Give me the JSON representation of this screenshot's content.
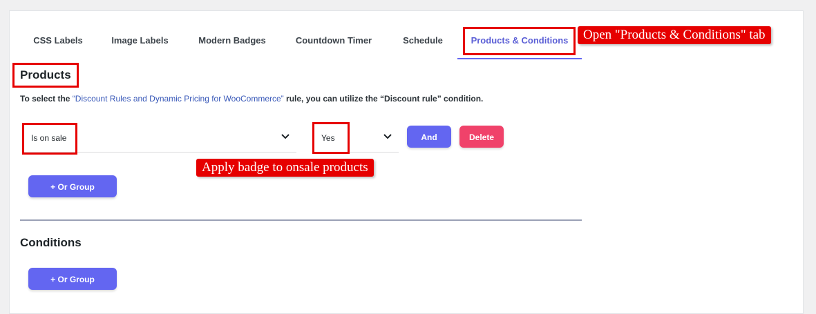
{
  "tabs": [
    {
      "label": "CSS Labels"
    },
    {
      "label": "Image Labels"
    },
    {
      "label": "Modern Badges"
    },
    {
      "label": "Countdown Timer"
    },
    {
      "label": "Schedule"
    },
    {
      "label": "Products & Conditions",
      "active": true
    }
  ],
  "annotations": {
    "open_tab": "Open \"Products & Conditions\" tab",
    "apply_badge": "Apply badge to onsale products"
  },
  "products": {
    "title": "Products",
    "help_prefix": "To select the ",
    "help_link": "“Discount Rules and Dynamic Pricing for WooCommerce”",
    "help_suffix": " rule, you can utilize the “Discount rule” condition.",
    "condition_select": {
      "value": "Is on sale"
    },
    "value_select": {
      "value": "Yes"
    },
    "and_button": "And",
    "delete_button": "Delete",
    "or_group_button": "+ Or Group"
  },
  "conditions": {
    "title": "Conditions",
    "or_group_button": "+ Or Group"
  },
  "colors": {
    "accent": "#6366f1",
    "danger": "#f0426a",
    "annotation_red": "#e60000"
  },
  "icons": [
    "chevron-down-icon"
  ]
}
